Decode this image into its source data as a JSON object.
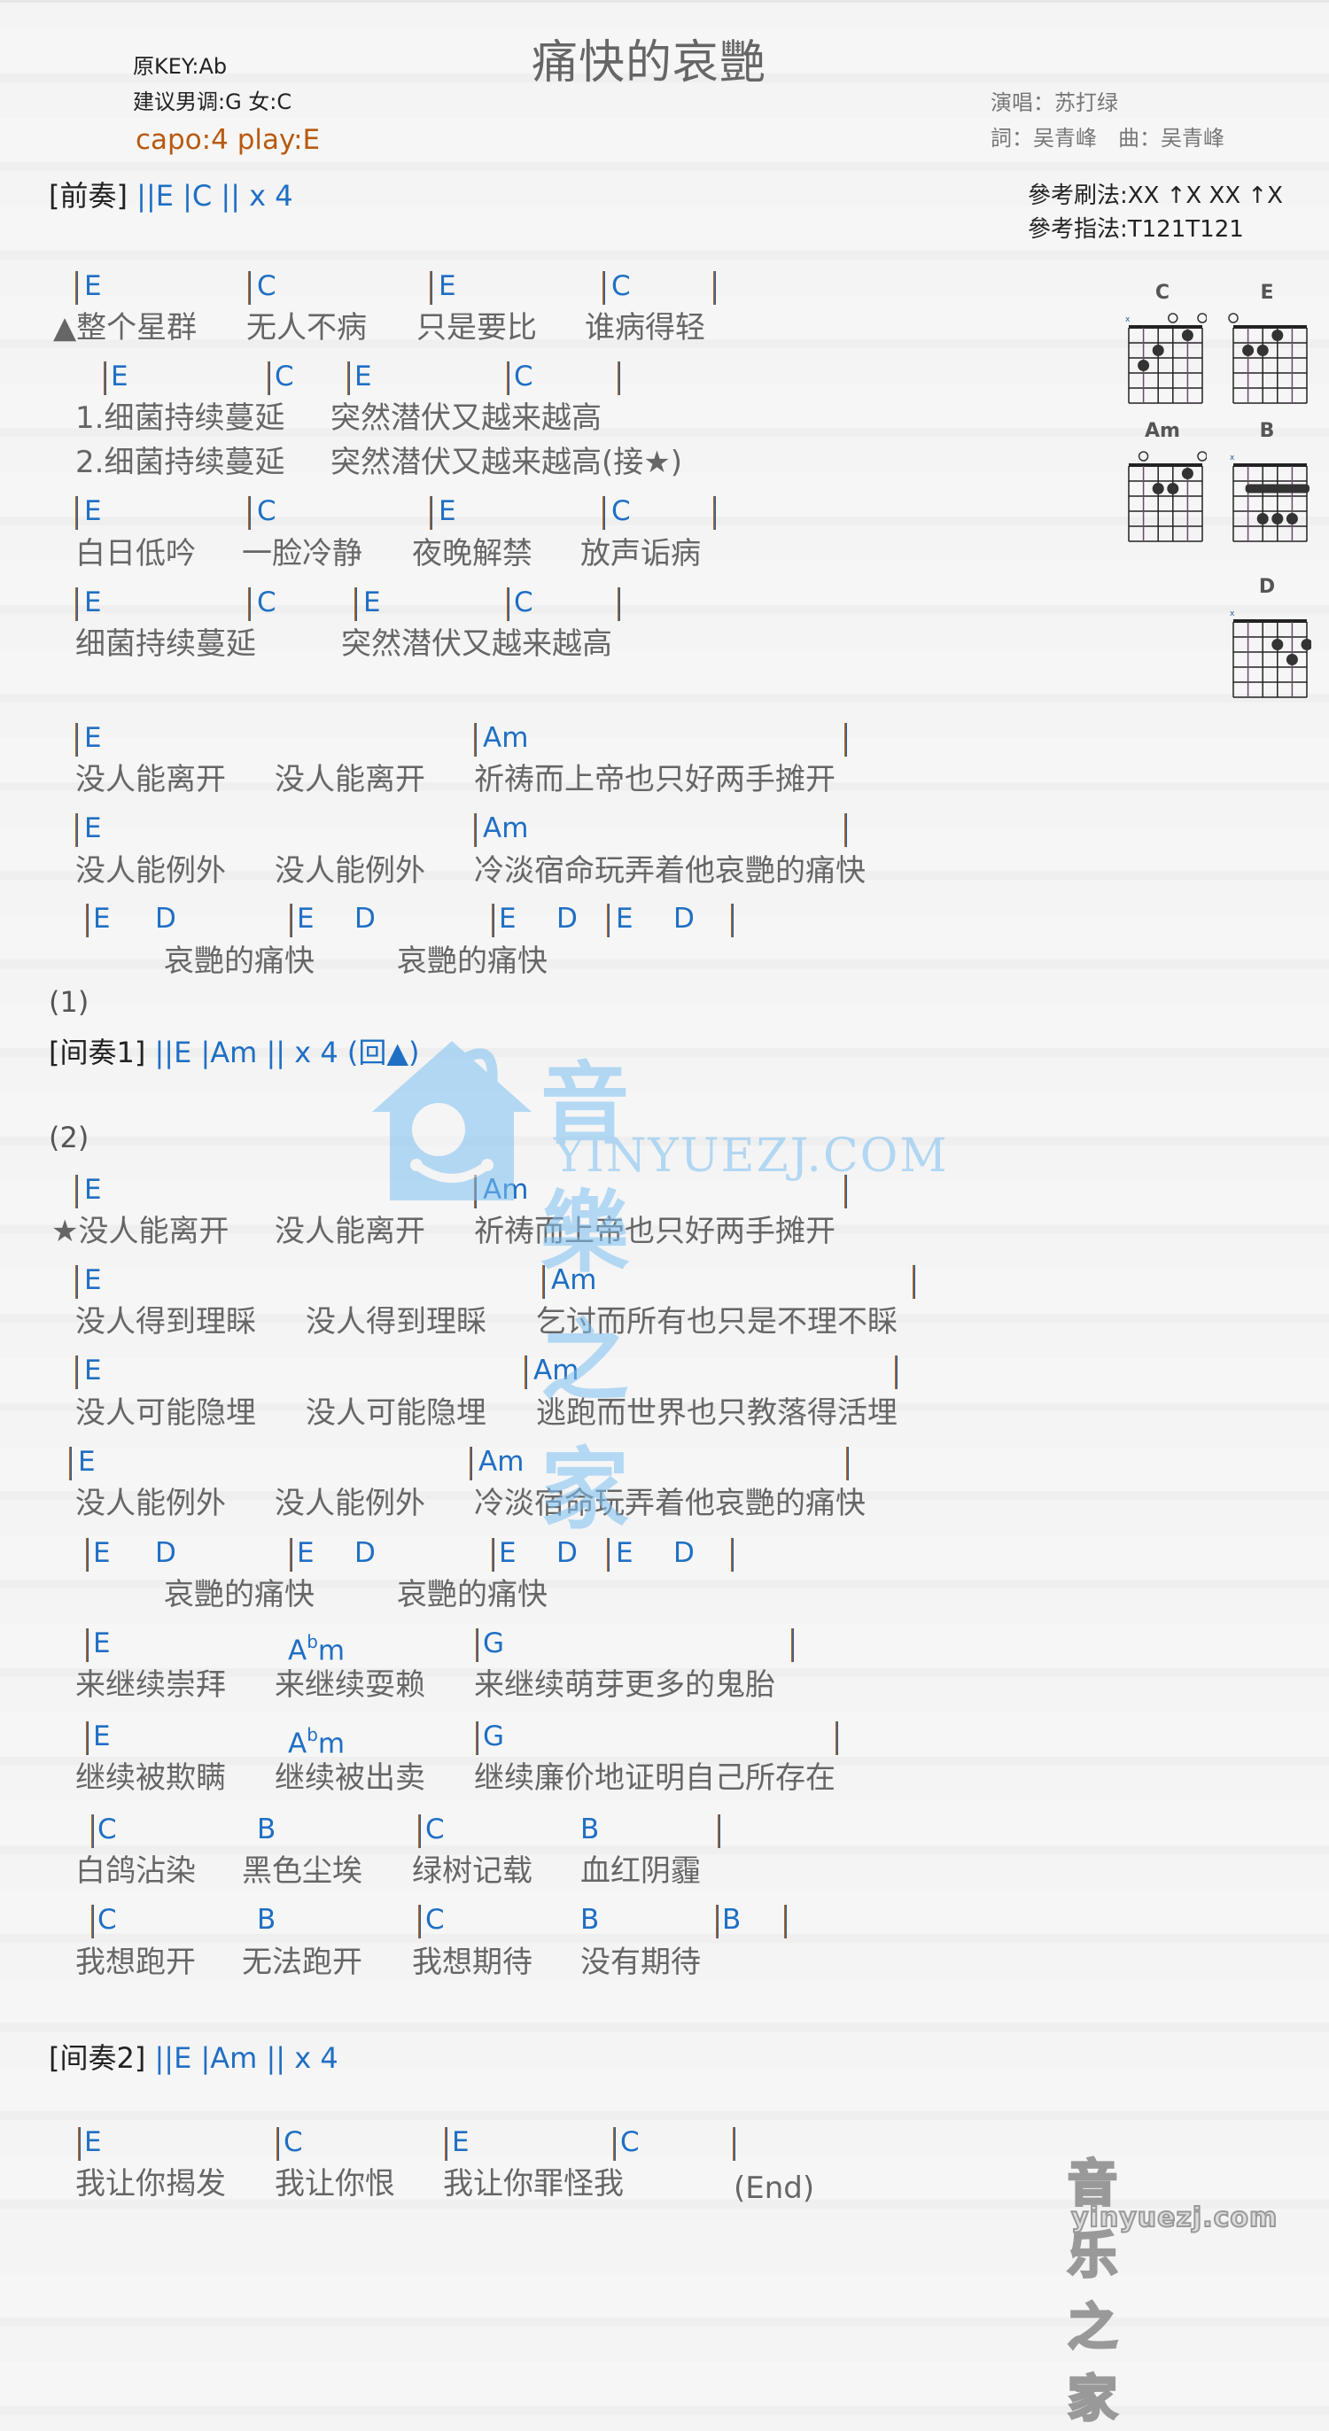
{
  "title": "痛快的哀艷",
  "meta": {
    "original_key": "原KEY:Ab",
    "suggested_key": "建议男调:G 女:C",
    "capo": "capo:4 play:E"
  },
  "credits": {
    "singer": "演唱：苏打绿",
    "writers": "詞：吴青峰　曲：吴青峰"
  },
  "reference": {
    "strum": "參考刷法:XX ↑X XX ↑X",
    "finger": "參考指法:T121T121"
  },
  "chord_diagrams": [
    {
      "name": "C",
      "muted": [
        6
      ],
      "open": [
        3,
        1
      ],
      "dots": [
        [
          5,
          3
        ],
        [
          4,
          2
        ],
        [
          2,
          1
        ]
      ],
      "barre": null
    },
    {
      "name": "E",
      "muted": [],
      "open": [
        6
      ],
      "dots": [
        [
          5,
          2
        ],
        [
          4,
          2
        ],
        [
          3,
          1
        ]
      ],
      "barre": null
    },
    {
      "name": "Am",
      "muted": [],
      "open": [
        5,
        1
      ],
      "dots": [
        [
          4,
          2
        ],
        [
          3,
          2
        ],
        [
          2,
          1
        ]
      ],
      "barre": null
    },
    {
      "name": "B",
      "muted": [
        6
      ],
      "open": [],
      "dots": [
        [
          4,
          4
        ],
        [
          3,
          4
        ],
        [
          2,
          4
        ]
      ],
      "barre": {
        "fret": 2,
        "from": 5,
        "to": 1
      }
    },
    {
      "name": "D",
      "muted": [
        6
      ],
      "open": [],
      "dots": [
        [
          3,
          2
        ],
        [
          1,
          2
        ],
        [
          2,
          3
        ]
      ],
      "barre": null
    }
  ],
  "sections": {
    "intro": {
      "label": "[前奏]",
      "chords": "||E   |C   || x 4"
    },
    "interlude1_marker": "(1)",
    "interlude1": {
      "label": "[间奏1]",
      "chords": "||E   |Am   || x 4   (回▲)"
    },
    "part2_marker": "(2)",
    "interlude2": {
      "label": "[间奏2]",
      "chords": "||E   |Am   || x 4"
    },
    "end": "(End)"
  },
  "lines": [
    {
      "chords": [
        "E",
        "C",
        "E",
        "C"
      ],
      "lyrics": [
        "▲整个星群",
        "无人不病",
        "只是要比",
        "谁病得轻"
      ]
    },
    {
      "chords": [
        "E",
        "C",
        "E",
        "C"
      ],
      "lyrics": [
        "1.细菌持续蔓延",
        "突然潜伏又越来越高"
      ]
    },
    {
      "chords": [],
      "lyrics": [
        "2.细菌持续蔓延",
        "突然潜伏又越来越高(接★)"
      ]
    },
    {
      "chords": [
        "E",
        "C",
        "E",
        "C"
      ],
      "lyrics": [
        "白日低吟",
        "一脸冷静",
        "夜晚解禁",
        "放声诟病"
      ]
    },
    {
      "chords": [
        "E",
        "C",
        "E",
        "C"
      ],
      "lyrics": [
        "细菌持续蔓延",
        "突然潜伏又越来越高"
      ]
    },
    {
      "chords": [
        "E",
        "Am"
      ],
      "lyrics": [
        "没人能离开",
        "没人能离开",
        "祈祷而上帝也只好两手摊开"
      ]
    },
    {
      "chords": [
        "E",
        "Am"
      ],
      "lyrics": [
        "没人能例外",
        "没人能例外",
        "冷淡宿命玩弄着他哀艷的痛快"
      ]
    },
    {
      "chords": [
        "E",
        "D",
        "E",
        "D",
        "E",
        "D",
        "E",
        "D"
      ],
      "lyrics": [
        "哀艷的痛快",
        "哀艷的痛快"
      ]
    },
    {
      "chords": [
        "E",
        "Am"
      ],
      "lyrics": [
        "★没人能离开",
        "没人能离开",
        "祈祷而上帝也只好两手摊开"
      ]
    },
    {
      "chords": [
        "E",
        "Am"
      ],
      "lyrics": [
        "没人得到理睬",
        "没人得到理睬",
        "乞讨而所有也只是不理不睬"
      ]
    },
    {
      "chords": [
        "E",
        "Am"
      ],
      "lyrics": [
        "没人可能隐埋",
        "没人可能隐埋",
        "逃跑而世界也只教落得活埋"
      ]
    },
    {
      "chords": [
        "E",
        "Am"
      ],
      "lyrics": [
        "没人能例外",
        "没人能例外",
        "冷淡宿命玩弄着他哀艷的痛快"
      ]
    },
    {
      "chords": [
        "E",
        "D",
        "E",
        "D",
        "E",
        "D",
        "E",
        "D"
      ],
      "lyrics": [
        "哀艷的痛快",
        "哀艷的痛快"
      ]
    },
    {
      "chords": [
        "E",
        "Abm",
        "G"
      ],
      "lyrics": [
        "来继续崇拜",
        "来继续耍赖",
        "来继续萌芽更多的鬼胎"
      ]
    },
    {
      "chords": [
        "E",
        "Abm",
        "G"
      ],
      "lyrics": [
        "继续被欺瞒",
        "继续被出卖",
        "继续廉价地证明自己所存在"
      ]
    },
    {
      "chords": [
        "C",
        "B",
        "C",
        "B"
      ],
      "lyrics": [
        "白鸽沾染",
        "黑色尘埃",
        "绿树记载",
        "血红阴霾"
      ]
    },
    {
      "chords": [
        "C",
        "B",
        "C",
        "B",
        "B"
      ],
      "lyrics": [
        "我想跑开",
        "无法跑开",
        "我想期待",
        "没有期待"
      ]
    },
    {
      "chords": [
        "E",
        "C",
        "E",
        "C"
      ],
      "lyrics": [
        "我让你揭发",
        "我让你恨",
        "我让你罪怪我"
      ]
    }
  ],
  "watermark": {
    "cn": "音樂之家",
    "en": "YINYUEZJ.COM"
  },
  "corner_logo": {
    "cn": "音乐之家",
    "en": "yinyuezj.com"
  }
}
